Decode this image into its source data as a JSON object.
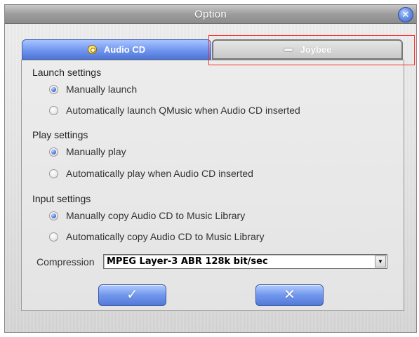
{
  "window": {
    "title": "Option"
  },
  "tabs": [
    {
      "label": "Audio CD",
      "icon": "cd-icon",
      "active": true
    },
    {
      "label": "Joybee",
      "icon": "joybee-device-icon",
      "active": false
    }
  ],
  "sections": {
    "launch": {
      "label": "Launch settings",
      "options": [
        {
          "label": "Manually launch",
          "checked": true
        },
        {
          "label": "Automatically launch QMusic when Audio CD inserted",
          "checked": false
        }
      ]
    },
    "play": {
      "label": "Play settings",
      "options": [
        {
          "label": "Manually play",
          "checked": true
        },
        {
          "label": "Automatically play when Audio CD inserted",
          "checked": false
        }
      ]
    },
    "input": {
      "label": "Input settings",
      "options": [
        {
          "label": "Manually copy Audio CD to Music Library",
          "checked": true
        },
        {
          "label": "Automatically copy Audio CD to Music Library",
          "checked": false
        }
      ]
    }
  },
  "compression": {
    "label": "Compression",
    "value": "MPEG Layer-3 ABR 128k bit/sec"
  },
  "buttons": {
    "ok_icon": "checkmark-icon",
    "cancel_icon": "x-icon",
    "ok_glyph": "✓",
    "cancel_glyph": "✕"
  },
  "colors": {
    "accent": "#6f95ee",
    "highlight": "#ff2b2b"
  }
}
